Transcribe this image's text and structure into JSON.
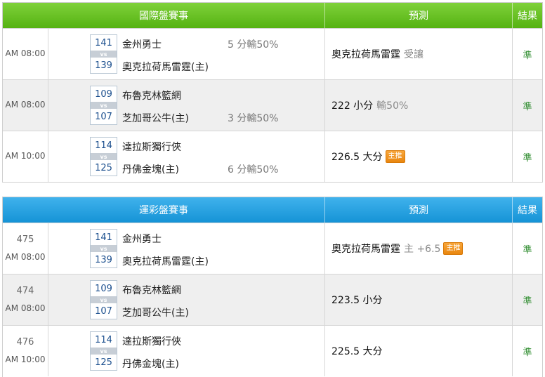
{
  "international": {
    "title": "國際盤賽事",
    "pred_header": "預測",
    "result_header": "結果",
    "rows": [
      {
        "time": "AM 08:00",
        "away_score": "141",
        "home_score": "139",
        "vs": "vs",
        "away": "金州勇士",
        "home": "奧克拉荷馬雷霆(主)",
        "spread_away": "5 分輸50%",
        "spread_home": "",
        "pred_main": "奧克拉荷馬雷霆",
        "pred_note": "受讓",
        "pred_tag": "",
        "result": "準"
      },
      {
        "time": "AM 08:00",
        "away_score": "109",
        "home_score": "107",
        "vs": "vs",
        "away": "布魯克林籃網",
        "home": "芝加哥公牛(主)",
        "spread_away": "",
        "spread_home": "3 分輸50%",
        "pred_main": "222 小分",
        "pred_note": "輸50%",
        "pred_tag": "",
        "result": "準"
      },
      {
        "time": "AM 10:00",
        "away_score": "114",
        "home_score": "125",
        "vs": "vs",
        "away": "達拉斯獨行俠",
        "home": "丹佛金塊(主)",
        "spread_away": "",
        "spread_home": "6 分輸50%",
        "pred_main": "226.5 大分",
        "pred_note": "",
        "pred_tag": "主推",
        "result": "準"
      }
    ]
  },
  "lottery": {
    "title": "運彩盤賽事",
    "pred_header": "預測",
    "result_header": "結果",
    "rows": [
      {
        "num": "475",
        "time": "AM 08:00",
        "away_score": "141",
        "home_score": "139",
        "vs": "vs",
        "away": "金州勇士",
        "home": "奧克拉荷馬雷霆(主)",
        "pred_main": "奧克拉荷馬雷霆",
        "pred_note": "主 +6.5",
        "pred_tag": "主推",
        "result": "準"
      },
      {
        "num": "474",
        "time": "AM 08:00",
        "away_score": "109",
        "home_score": "107",
        "vs": "vs",
        "away": "布魯克林籃網",
        "home": "芝加哥公牛(主)",
        "pred_main": "223.5 小分",
        "pred_note": "",
        "pred_tag": "",
        "result": "準"
      },
      {
        "num": "476",
        "time": "AM 10:00",
        "away_score": "114",
        "home_score": "125",
        "vs": "vs",
        "away": "達拉斯獨行俠",
        "home": "丹佛金塊(主)",
        "pred_main": "225.5 大分",
        "pred_note": "",
        "pred_tag": "",
        "result": "準"
      }
    ]
  },
  "colors": {
    "intl_header": "#55b212",
    "lottery_header": "#1593d6",
    "result_text": "#2a8a2a",
    "tag": "#e9860f"
  }
}
